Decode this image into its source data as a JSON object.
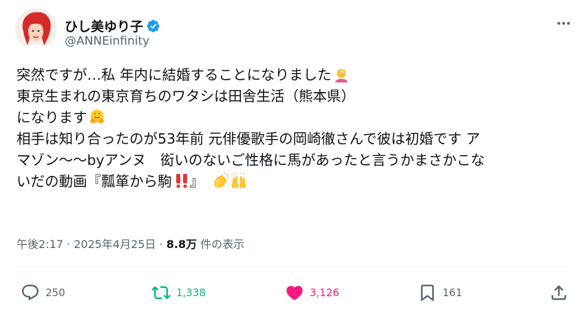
{
  "author": {
    "display_name": "ひし美ゆり子",
    "handle": "@ANNEinfinity",
    "verified": true
  },
  "tweet": {
    "line1": "突然ですが…私 年内に結婚することになりました",
    "line1_emoji": "face-palm-emoji",
    "line2": "東京生まれの東京育ちのワタシは田舎生活（熊本県）",
    "line3": "になります",
    "line3_emoji": "hugging-face-emoji",
    "line4": "相手は知り合ったのが53年前 元俳優歌手の岡崎徹さんで彼は初婚です アマゾン〜〜byアンヌ　衒いのないご性格に馬があったと言うかまさかこない",
    "line4a": "相手は知り合ったのが53年前 元俳優歌手の岡崎徹さんで彼は初婚です ア",
    "line4b": "マゾン〜〜byアンヌ　衒いのないご性格に馬があったと言うかまさかこな",
    "line5": "いだの動画『瓢箪から駒",
    "line5_end": "』",
    "line5_emojis": [
      "double-exclamation-emoji",
      "clapping-hands-emoji",
      "raising-hands-emoji"
    ]
  },
  "meta": {
    "time": "午後2:17",
    "separator1": " · ",
    "date": "2025年4月25日",
    "separator2": " · ",
    "views": "8.8万",
    "views_label": " 件の表示"
  },
  "actions": {
    "replies": "250",
    "reposts": "1,338",
    "likes": "3,126",
    "bookmarks": "161"
  },
  "colors": {
    "text": "#0f1419",
    "secondary": "#536471",
    "verified": "#1d9bf0",
    "repost": "#00ba7c",
    "like": "#f91880"
  }
}
